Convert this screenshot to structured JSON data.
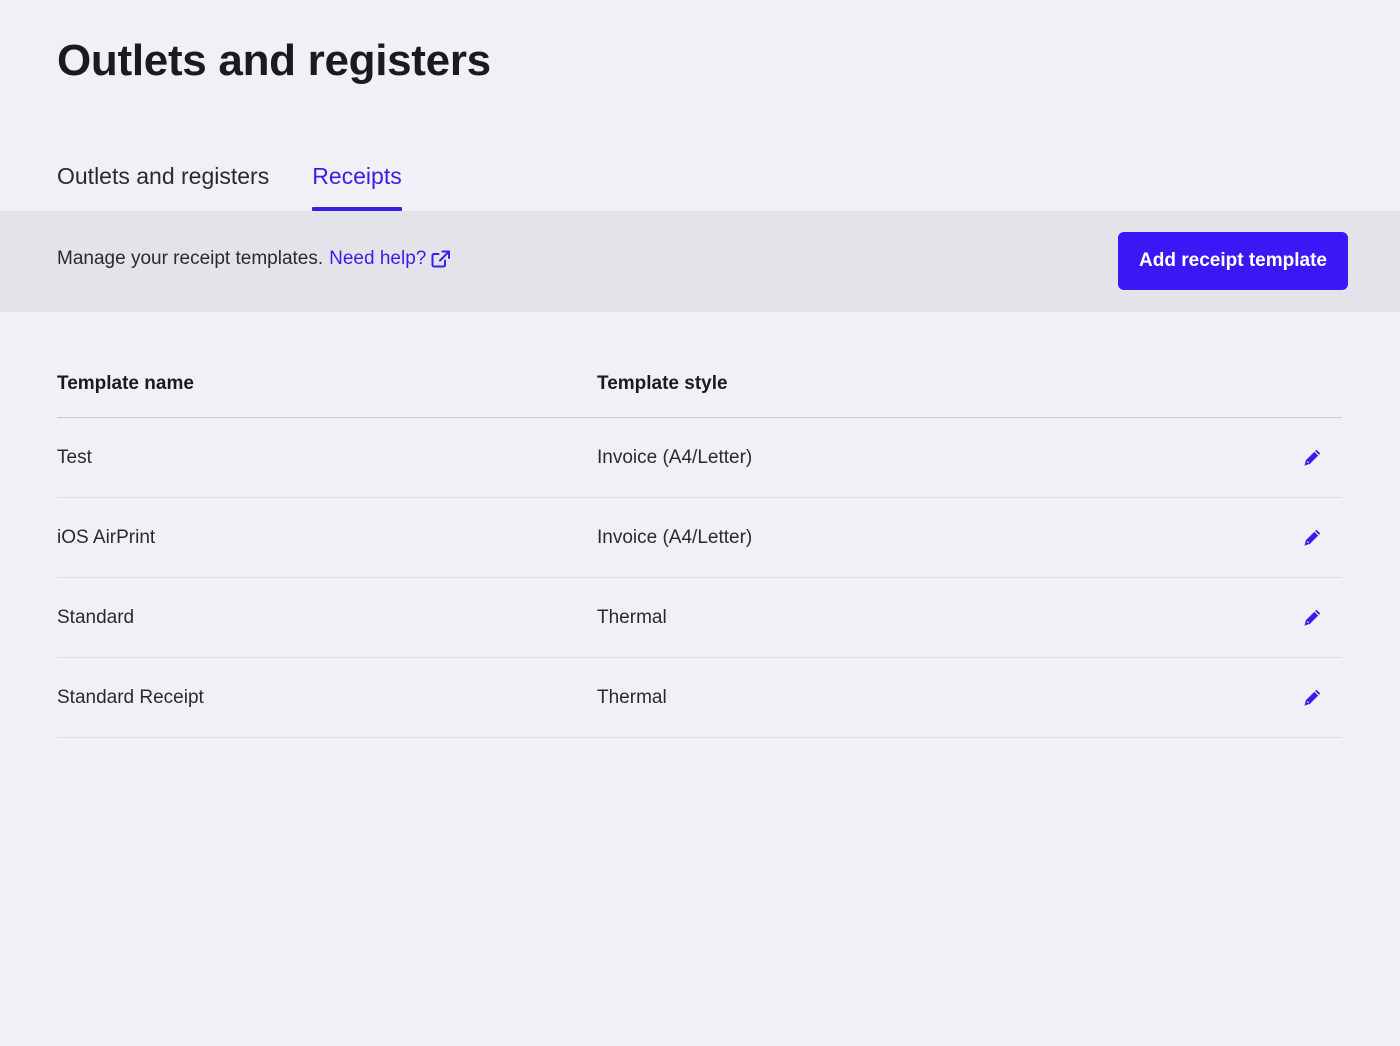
{
  "page": {
    "title": "Outlets and registers"
  },
  "tabs": [
    {
      "label": "Outlets and registers",
      "active": false
    },
    {
      "label": "Receipts",
      "active": true
    }
  ],
  "banner": {
    "description": "Manage your receipt templates.",
    "help_link": "Need help?",
    "help_icon": "external-link-icon",
    "add_button": "Add receipt template"
  },
  "table": {
    "headers": {
      "name": "Template name",
      "style": "Template style"
    },
    "rows": [
      {
        "name": "Test",
        "style": "Invoice (A4/Letter)",
        "action_icon": "pencil-icon"
      },
      {
        "name": "iOS AirPrint",
        "style": "Invoice (A4/Letter)",
        "action_icon": "pencil-icon"
      },
      {
        "name": "Standard",
        "style": "Thermal",
        "action_icon": "pencil-icon"
      },
      {
        "name": "Standard Receipt",
        "style": "Thermal",
        "action_icon": "pencil-icon"
      }
    ]
  },
  "colors": {
    "accent": "#3a1ee6",
    "button": "#3a18f5",
    "background": "#f0f1f6",
    "banner": "#e3e4ea"
  }
}
